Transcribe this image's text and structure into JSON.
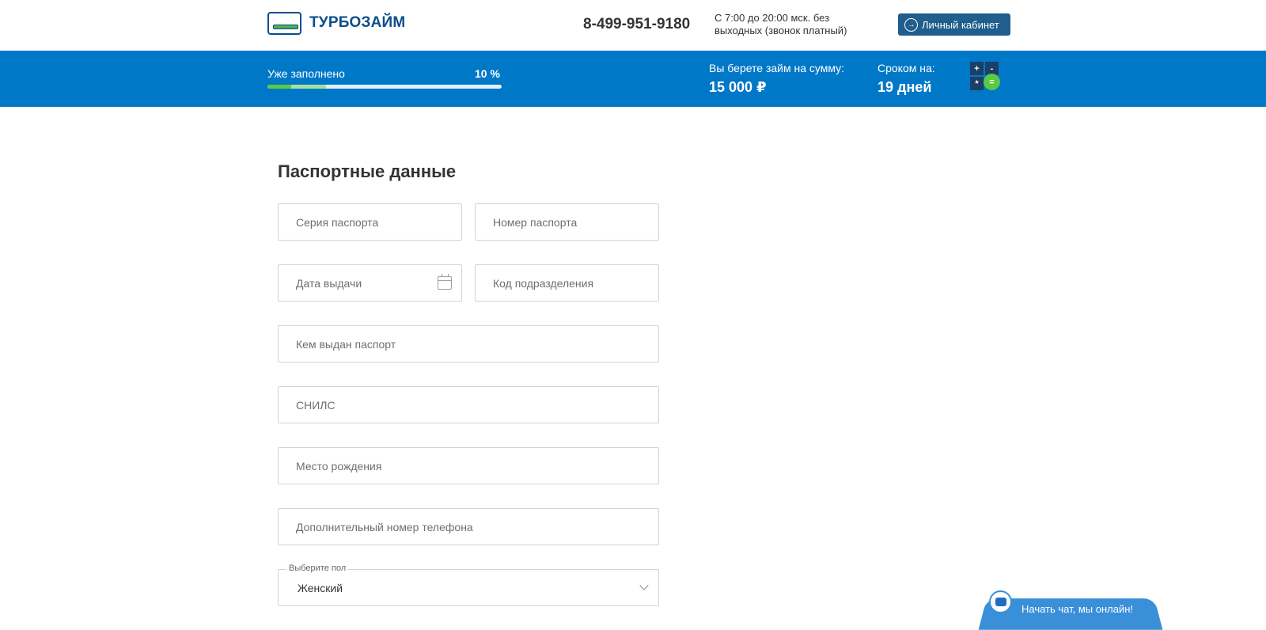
{
  "header": {
    "logo_text": "ТУРБОЗАЙМ",
    "phone": "8-499-951-9180",
    "hours": "С 7:00 до 20:00 мск. без выходных (звонок платный)",
    "cabinet_label": "Личный кабинет"
  },
  "progress_bar": {
    "label": "Уже заполнено",
    "percent_text": "10 %",
    "percent": 10
  },
  "loan": {
    "amount_label": "Вы берете займ на сумму:",
    "amount_value": "15 000 ₽",
    "term_label": "Сроком на:",
    "term_value": "19 дней"
  },
  "calculator": {
    "keys": [
      "+",
      "-",
      "*",
      "="
    ]
  },
  "form": {
    "title": "Паспортные данные",
    "fields": {
      "passport_series": "Серия паспорта",
      "passport_number": "Номер паспорта",
      "issue_date": "Дата выдачи",
      "division_code": "Код подразделения",
      "issued_by": "Кем выдан паспорт",
      "snils": "СНИЛС",
      "birth_place": "Место рождения",
      "extra_phone": "Дополнительный номер телефона"
    },
    "gender": {
      "legend": "Выберите пол",
      "value": "Женский"
    }
  },
  "chat": {
    "label": "Начать чат, мы онлайн!"
  },
  "colors": {
    "brand_blue": "#0078c8",
    "dark_blue": "#1f5e8d",
    "accent_green": "#5cc843"
  }
}
